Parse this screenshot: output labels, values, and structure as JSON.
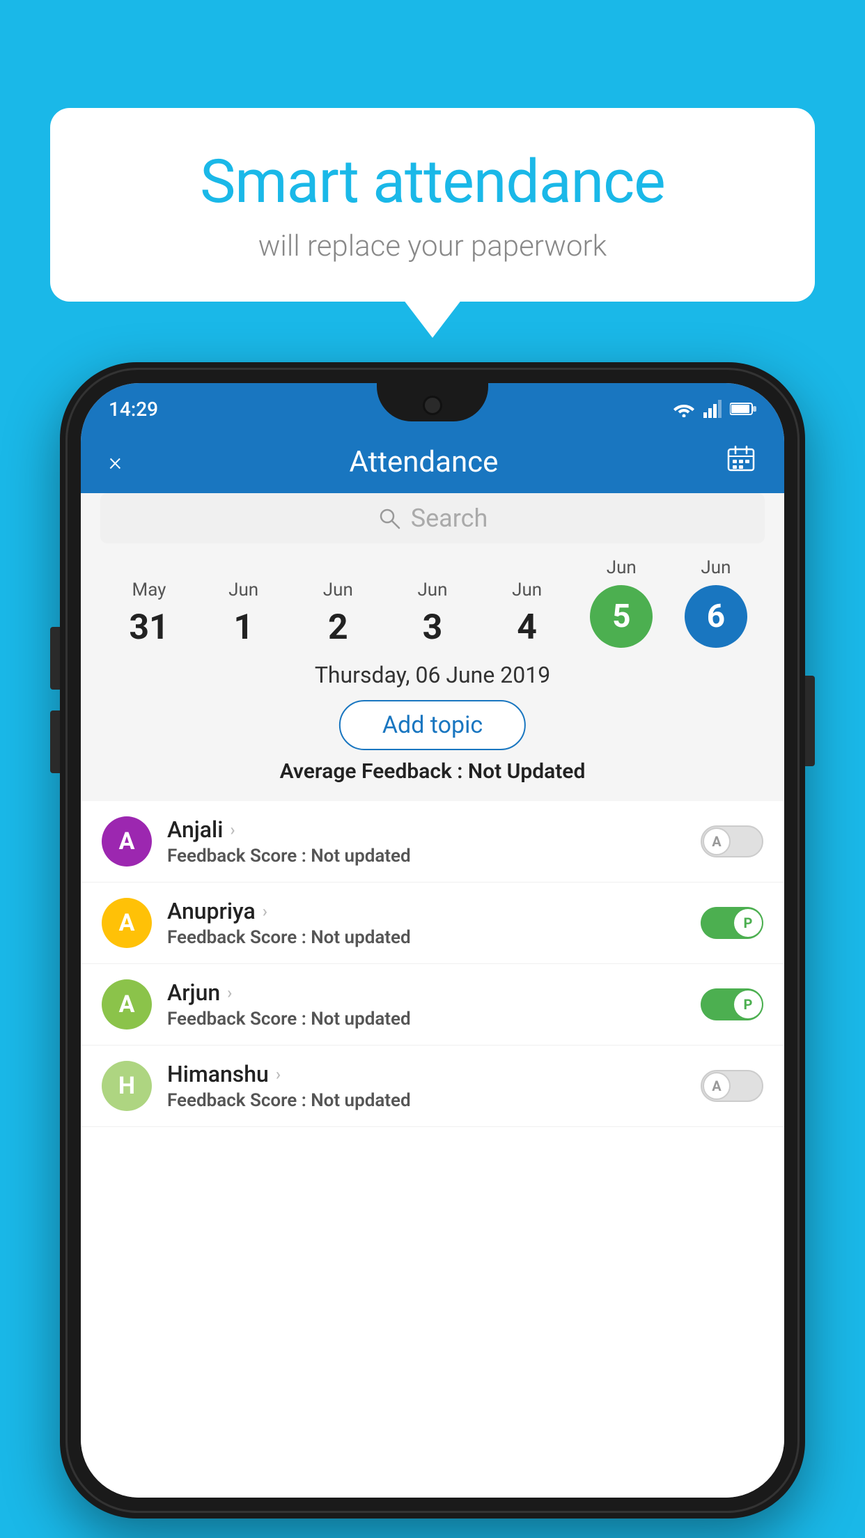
{
  "background_color": "#1ab8e8",
  "speech_bubble": {
    "title": "Smart attendance",
    "subtitle": "will replace your paperwork"
  },
  "status_bar": {
    "time": "14:29",
    "icons": [
      "wifi",
      "signal",
      "battery"
    ]
  },
  "app_header": {
    "title": "Attendance",
    "close_label": "×",
    "calendar_label": "📅"
  },
  "search": {
    "placeholder": "Search"
  },
  "date_strip": {
    "dates": [
      {
        "month": "May",
        "day": "31",
        "state": "normal"
      },
      {
        "month": "Jun",
        "day": "1",
        "state": "normal"
      },
      {
        "month": "Jun",
        "day": "2",
        "state": "normal"
      },
      {
        "month": "Jun",
        "day": "3",
        "state": "normal"
      },
      {
        "month": "Jun",
        "day": "4",
        "state": "normal"
      },
      {
        "month": "Jun",
        "day": "5",
        "state": "today"
      },
      {
        "month": "Jun",
        "day": "6",
        "state": "selected"
      }
    ]
  },
  "selected_date_label": "Thursday, 06 June 2019",
  "add_topic_label": "Add topic",
  "average_feedback": {
    "label": "Average Feedback : ",
    "value": "Not Updated"
  },
  "students": [
    {
      "name": "Anjali",
      "avatar_letter": "A",
      "avatar_color": "#9c27b0",
      "feedback_label": "Feedback Score : ",
      "feedback_value": "Not updated",
      "attendance": "absent",
      "toggle_letter": "A"
    },
    {
      "name": "Anupriya",
      "avatar_letter": "A",
      "avatar_color": "#ffc107",
      "feedback_label": "Feedback Score : ",
      "feedback_value": "Not updated",
      "attendance": "present",
      "toggle_letter": "P"
    },
    {
      "name": "Arjun",
      "avatar_letter": "A",
      "avatar_color": "#8bc34a",
      "feedback_label": "Feedback Score : ",
      "feedback_value": "Not updated",
      "attendance": "present",
      "toggle_letter": "P"
    },
    {
      "name": "Himanshu",
      "avatar_letter": "H",
      "avatar_color": "#aed581",
      "feedback_label": "Feedback Score : ",
      "feedback_value": "Not updated",
      "attendance": "absent",
      "toggle_letter": "A"
    }
  ]
}
